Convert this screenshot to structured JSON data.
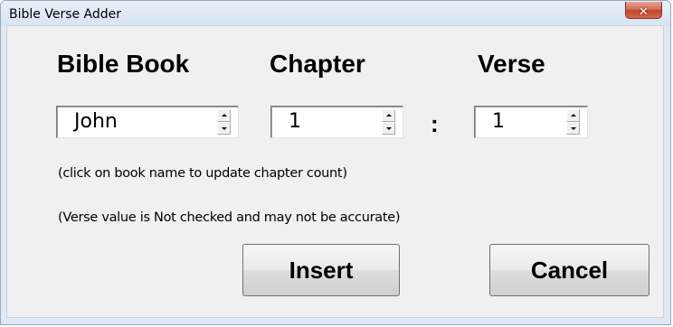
{
  "window": {
    "title": "Bible Verse Adder",
    "close_icon": "close-x-icon",
    "accent_close": "#c8452f"
  },
  "headings": {
    "book": "Bible Book",
    "chapter": "Chapter",
    "verse": "Verse"
  },
  "fields": {
    "book": "John",
    "chapter": "1",
    "separator": ":",
    "verse": "1"
  },
  "notes": {
    "hint1": "(click on book name to update chapter count)",
    "hint2": "(Verse value is Not checked and may not be accurate)"
  },
  "buttons": {
    "insert": "Insert",
    "cancel": "Cancel"
  }
}
